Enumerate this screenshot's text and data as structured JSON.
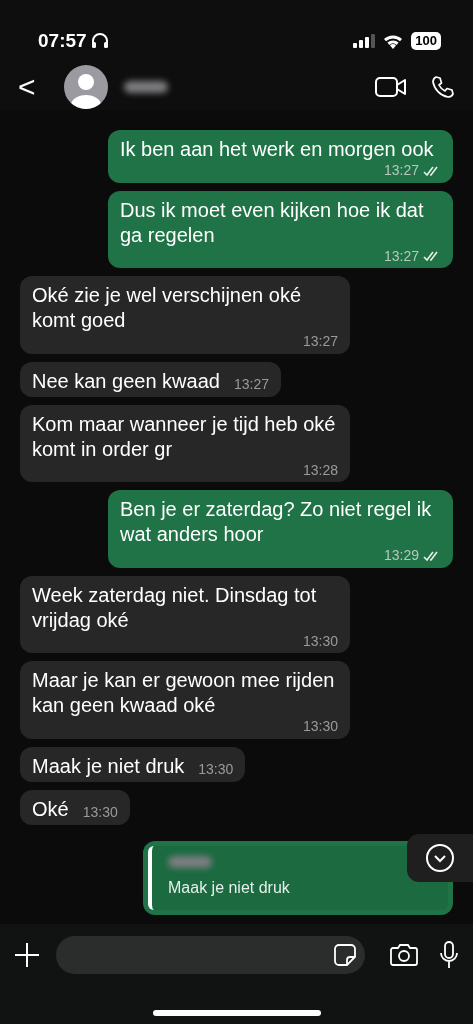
{
  "status_bar": {
    "time": "07:57",
    "battery": "100"
  },
  "header": {
    "back": "<"
  },
  "messages": [
    {
      "outgoing": true,
      "text": "Ik ben aan het werk en morgen ook",
      "time": "13:27",
      "read": false
    },
    {
      "outgoing": true,
      "text": "Dus ik moet even kijken hoe ik dat ga regelen",
      "time": "13:27",
      "read": false
    },
    {
      "outgoing": false,
      "text": "Oké zie je wel verschijnen oké komt goed",
      "time": "13:27"
    },
    {
      "outgoing": false,
      "text": "Nee kan geen kwaad",
      "time": "13:27"
    },
    {
      "outgoing": false,
      "text": "Kom maar wanneer je tijd heb oké komt in order gr",
      "time": "13:28"
    },
    {
      "outgoing": true,
      "text": "Ben je er zaterdag? Zo niet regel ik wat anders hoor",
      "time": "13:29",
      "read": false
    },
    {
      "outgoing": false,
      "text": "Week zaterdag niet. Dinsdag tot vrijdag oké",
      "time": "13:30"
    },
    {
      "outgoing": false,
      "text": "Maar je kan er gewoon mee rijden kan geen kwaad oké",
      "time": "13:30"
    },
    {
      "outgoing": false,
      "text": "Maak je niet druk",
      "time": "13:30"
    },
    {
      "outgoing": false,
      "text": "Oké",
      "time": "13:30"
    },
    {
      "outgoing": true,
      "quote": "Maak je niet druk"
    }
  ]
}
